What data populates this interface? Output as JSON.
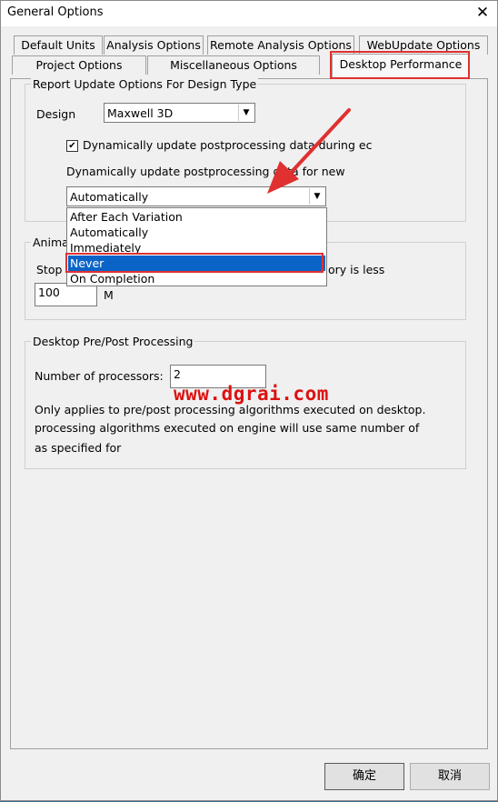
{
  "window": {
    "title": "General Options",
    "close_glyph": "✕"
  },
  "tabs_row1": [
    "Default Units",
    "Analysis Options",
    "Remote Analysis Options",
    "WebUpdate Options"
  ],
  "tabs_row2": [
    "Project Options",
    "Miscellaneous Options",
    "Desktop Performance"
  ],
  "active_tab": "Desktop Performance",
  "report_update": {
    "group_title": "Report Update Options For Design Type",
    "design_label": "Design",
    "design_value": "Maxwell 3D",
    "checkbox_checked": true,
    "checkbox_label": "Dynamically update postprocessing data during ec",
    "dynamic_label": "Dynamically update postprocessing data for new",
    "dynamic_value": "Automatically",
    "dropdown_options": [
      "After Each Variation",
      "Automatically",
      "Immediately",
      "Never",
      "On Completion"
    ],
    "dropdown_selected": "Never"
  },
  "animation": {
    "group_title_partial": "Anima",
    "stop_label_partial": "Stop",
    "memory_text_partial": "ory is less",
    "value": "100",
    "unit": "M"
  },
  "prepost": {
    "group_title": "Desktop Pre/Post Processing",
    "processors_label": "Number of processors:",
    "processors_value": "2",
    "note_line1": "Only applies to pre/post processing algorithms executed on desktop.",
    "note_line2": "processing algorithms executed on engine will use same number of",
    "note_line3": "as specified for"
  },
  "watermark": "www.dgrai.com",
  "buttons": {
    "ok": "确定",
    "cancel": "取消"
  },
  "annotation_color": "#e03030"
}
